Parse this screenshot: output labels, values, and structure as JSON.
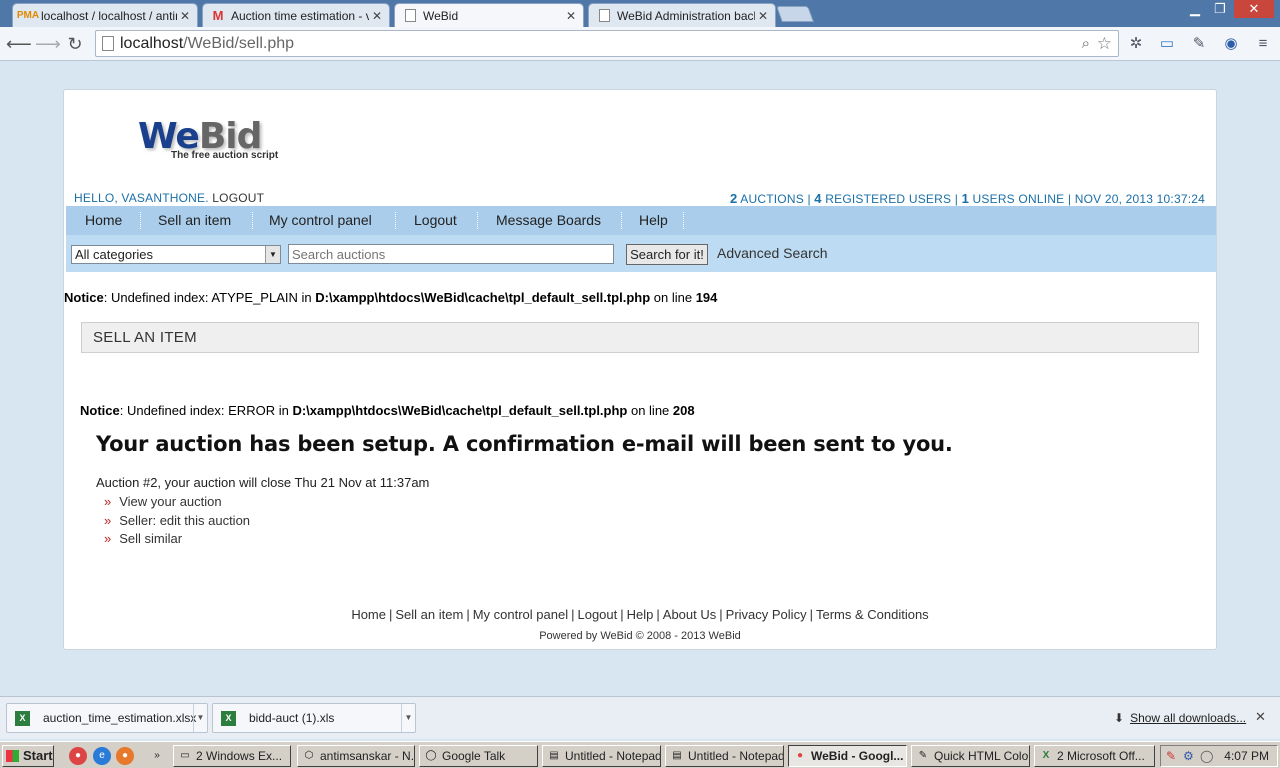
{
  "browser": {
    "tabs": [
      {
        "title": "localhost / localhost / antimsa",
        "icon": "phpmyadmin-icon"
      },
      {
        "title": "Auction time estimation - vas",
        "icon": "gmail-icon"
      },
      {
        "title": "WeBid",
        "icon": "page-icon"
      },
      {
        "title": "WeBid Administration back-en",
        "icon": "page-icon"
      }
    ],
    "url_host": "localhost",
    "url_path": "/WeBid/sell.php"
  },
  "site": {
    "logo_main": "We",
    "logo_accent": "Bid",
    "logo_tagline": "The free auction script",
    "hello": "HELLO, VASANTHONE.",
    "logout": "LOGOUT",
    "stats": {
      "auctions_count": "2",
      "auctions_label": "AUCTIONS",
      "users_count": "4",
      "users_label": "REGISTERED USERS",
      "online_count": "1",
      "online_label": "USERS ONLINE",
      "datetime": "NOV 20, 2013 10:37:24"
    },
    "nav": [
      "Home",
      "Sell an item",
      "My control panel",
      "Logout",
      "Message Boards",
      "Help"
    ],
    "search": {
      "category": "All categories",
      "placeholder": "Search auctions",
      "button": "Search for it!",
      "advanced": "Advanced Search"
    }
  },
  "notices": [
    {
      "label": "Notice",
      "text": ": Undefined index: ATYPE_PLAIN in ",
      "file": "D:\\xampp\\htdocs\\WeBid\\cache\\tpl_default_sell.tpl.php",
      "online": " on line ",
      "line": "194"
    },
    {
      "label": "Notice",
      "text": ": Undefined index: ERROR in ",
      "file": "D:\\xampp\\htdocs\\WeBid\\cache\\tpl_default_sell.tpl.php",
      "online": " on line ",
      "line": "208"
    }
  ],
  "main": {
    "heading": "SELL AN ITEM",
    "confirmation": "Your auction has been setup. A confirmation e-mail will been sent to you.",
    "close_info": "Auction #2, your auction will close Thu 21 Nov at 11:37am",
    "bullet": "»",
    "links": [
      "View your auction",
      "Seller: edit this auction",
      "Sell similar"
    ]
  },
  "footer": {
    "links": [
      "Home",
      "Sell an item",
      "My control panel",
      "Logout",
      "Help",
      "About Us",
      "Privacy Policy",
      "Terms & Conditions"
    ],
    "powered": "Powered by WeBid © 2008 - 2013 WeBid"
  },
  "downloads": {
    "items": [
      "auction_time_estimation.xlsx",
      "bidd-auct (1).xls"
    ],
    "show_all": "Show all downloads..."
  },
  "taskbar": {
    "start": "Start",
    "tasks": [
      "2 Windows Ex...",
      "antimsanskar - N...",
      "Google Talk",
      "Untitled - Notepad",
      "Untitled - Notepad",
      "WeBid - Googl...",
      "Quick HTML Colo...",
      "2 Microsoft Off..."
    ],
    "clock": "4:07 PM"
  }
}
